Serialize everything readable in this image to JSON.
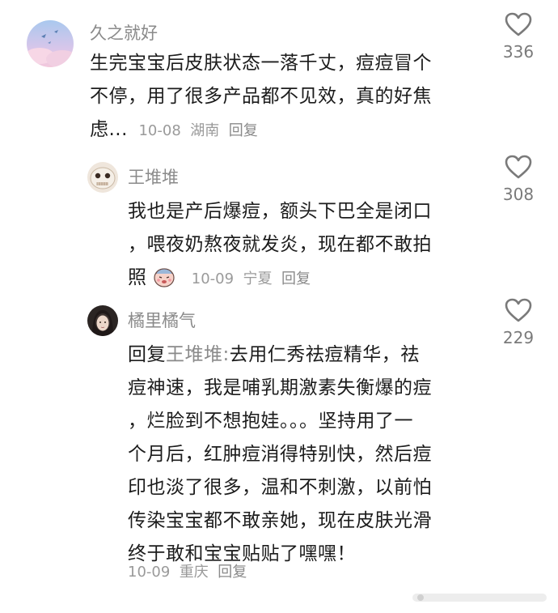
{
  "comments": [
    {
      "username": "久之就好",
      "text_lines": [
        "生完宝宝后皮肤状态一落千丈，痘痘冒个",
        "不停，用了很多产品都不见效，真的好焦",
        "虑..."
      ],
      "date": "10-08",
      "location": "湖南",
      "reply_label": "回复",
      "likes": "336"
    },
    {
      "username": "王堆堆",
      "text_lines": [
        "我也是产后爆痘，额头下巴全是闭口",
        "，喂夜奶熬夜就发炎，现在都不敢拍",
        "照"
      ],
      "date": "10-09",
      "location": "宁夏",
      "reply_label": "回复",
      "likes": "308"
    },
    {
      "username": "橘里橘气",
      "reply_prefix": "回复",
      "mention": "王堆堆:",
      "text_lines": [
        "去用仁秀祛痘精华，祛",
        "痘神速，我是哺乳期激素失衡爆的痘",
        "，烂脸到不想抱娃。。。坚持用了一",
        "个月后，红肿痘消得特别快，然后痘",
        "印也淡了很多，温和不刺激，以前怕",
        "传染宝宝都不敢亲她，现在皮肤光滑",
        "终于敢和宝宝贴贴了嘿嘿！"
      ],
      "date": "10-09",
      "location": "重庆",
      "reply_label": "回复",
      "likes": "229"
    }
  ],
  "icons": {
    "like": "heart-outline-icon",
    "sticker": "crying-face-sticker-icon"
  },
  "colors": {
    "username": "#8a8a8a",
    "text": "#1c1c1c",
    "meta": "#9a9a9a",
    "like_count": "#7a7a7a"
  }
}
